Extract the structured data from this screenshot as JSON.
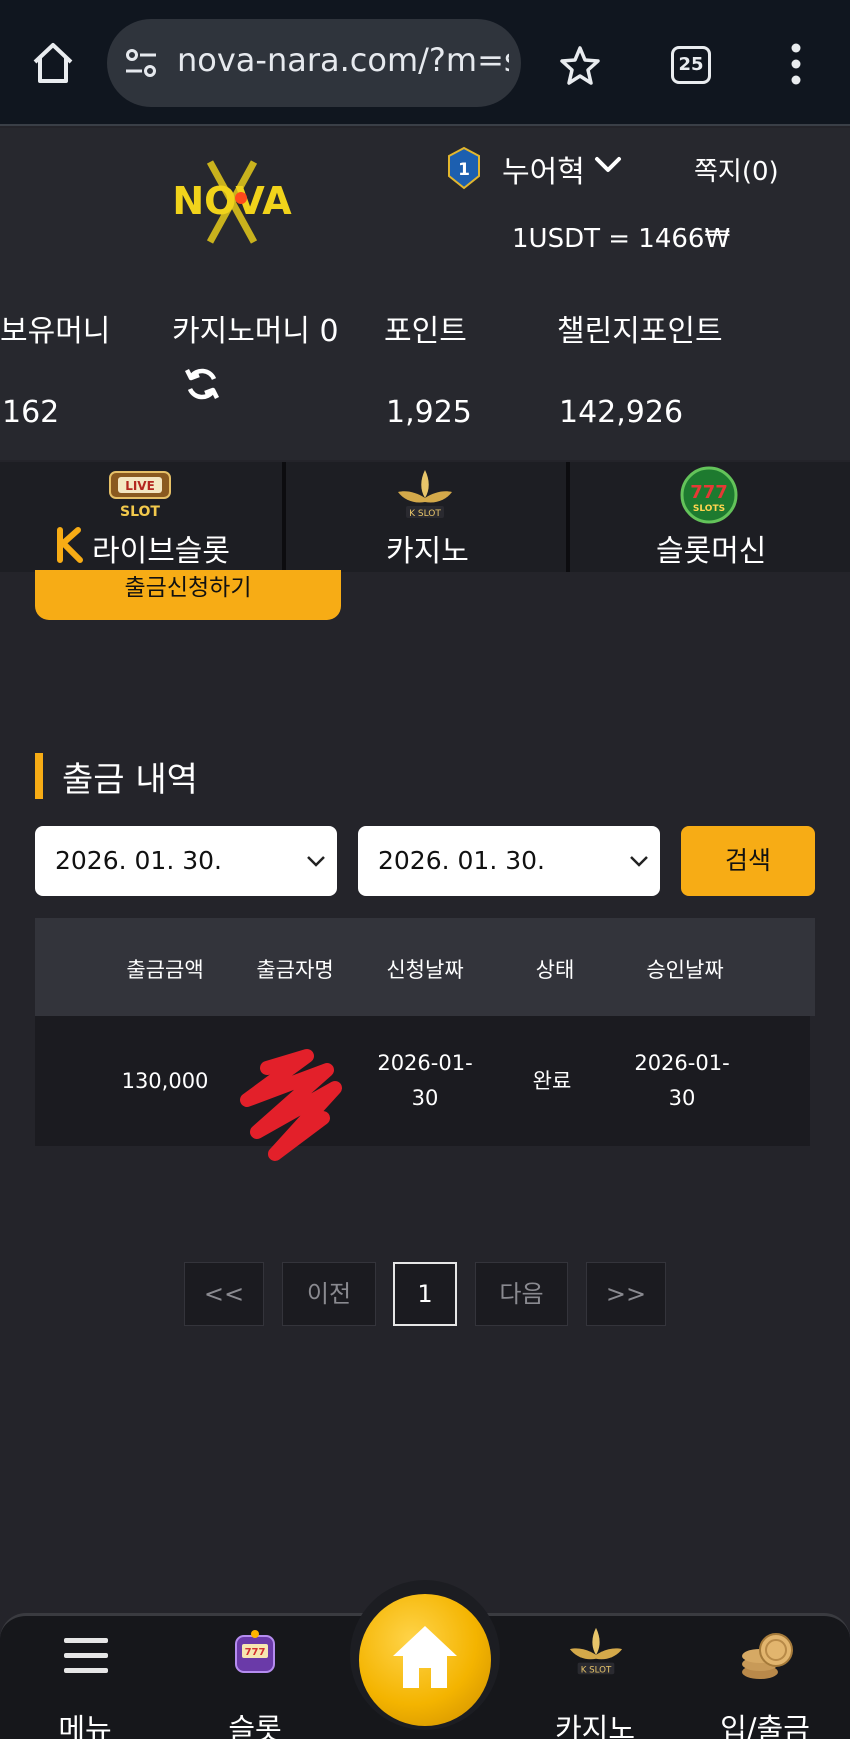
{
  "browser": {
    "url": "nova-nara.com/?m=s",
    "tab_count": "25"
  },
  "header": {
    "logo_text": "NOVA",
    "level": "1",
    "username": "누어혁",
    "messages": "쪽지(0)",
    "rate": "1USDT = 1466₩"
  },
  "stats": {
    "money_label": "보유머니",
    "money_value": "162",
    "casino_label": "카지노머니 0",
    "points_label": "포인트",
    "points_value": "1,925",
    "challenge_label": "챌린지포인트",
    "challenge_value": "142,926"
  },
  "categories": [
    {
      "label": "라이브슬롯",
      "icon": "live-slot-icon"
    },
    {
      "label": "카지노",
      "icon": "k-slot-lotus-icon"
    },
    {
      "label": "슬롯머신",
      "icon": "777-slots-icon"
    }
  ],
  "withdraw_button": "출금신청하기",
  "history": {
    "title": "출금 내역",
    "date_from": "2026. 01. 30.",
    "date_to": "2026. 01. 30.",
    "search_label": "검색",
    "columns": [
      "출금금액",
      "출금자명",
      "신청날짜",
      "상태",
      "승인날짜"
    ],
    "rows": [
      {
        "amount": "130,000",
        "name": "",
        "request_date_1": "2026-01-",
        "request_date_2": "30",
        "status": "완료",
        "approve_date_1": "2026-01-",
        "approve_date_2": "30"
      }
    ]
  },
  "pagination": {
    "first": "<<",
    "prev": "이전",
    "current": "1",
    "next": "다음",
    "last": ">>"
  },
  "bottom_nav": {
    "menu": "메뉴",
    "slot": "슬롯",
    "casino": "카지노",
    "deposit": "입/출금"
  },
  "colors": {
    "accent": "#f7ac15",
    "background": "#24242a"
  }
}
